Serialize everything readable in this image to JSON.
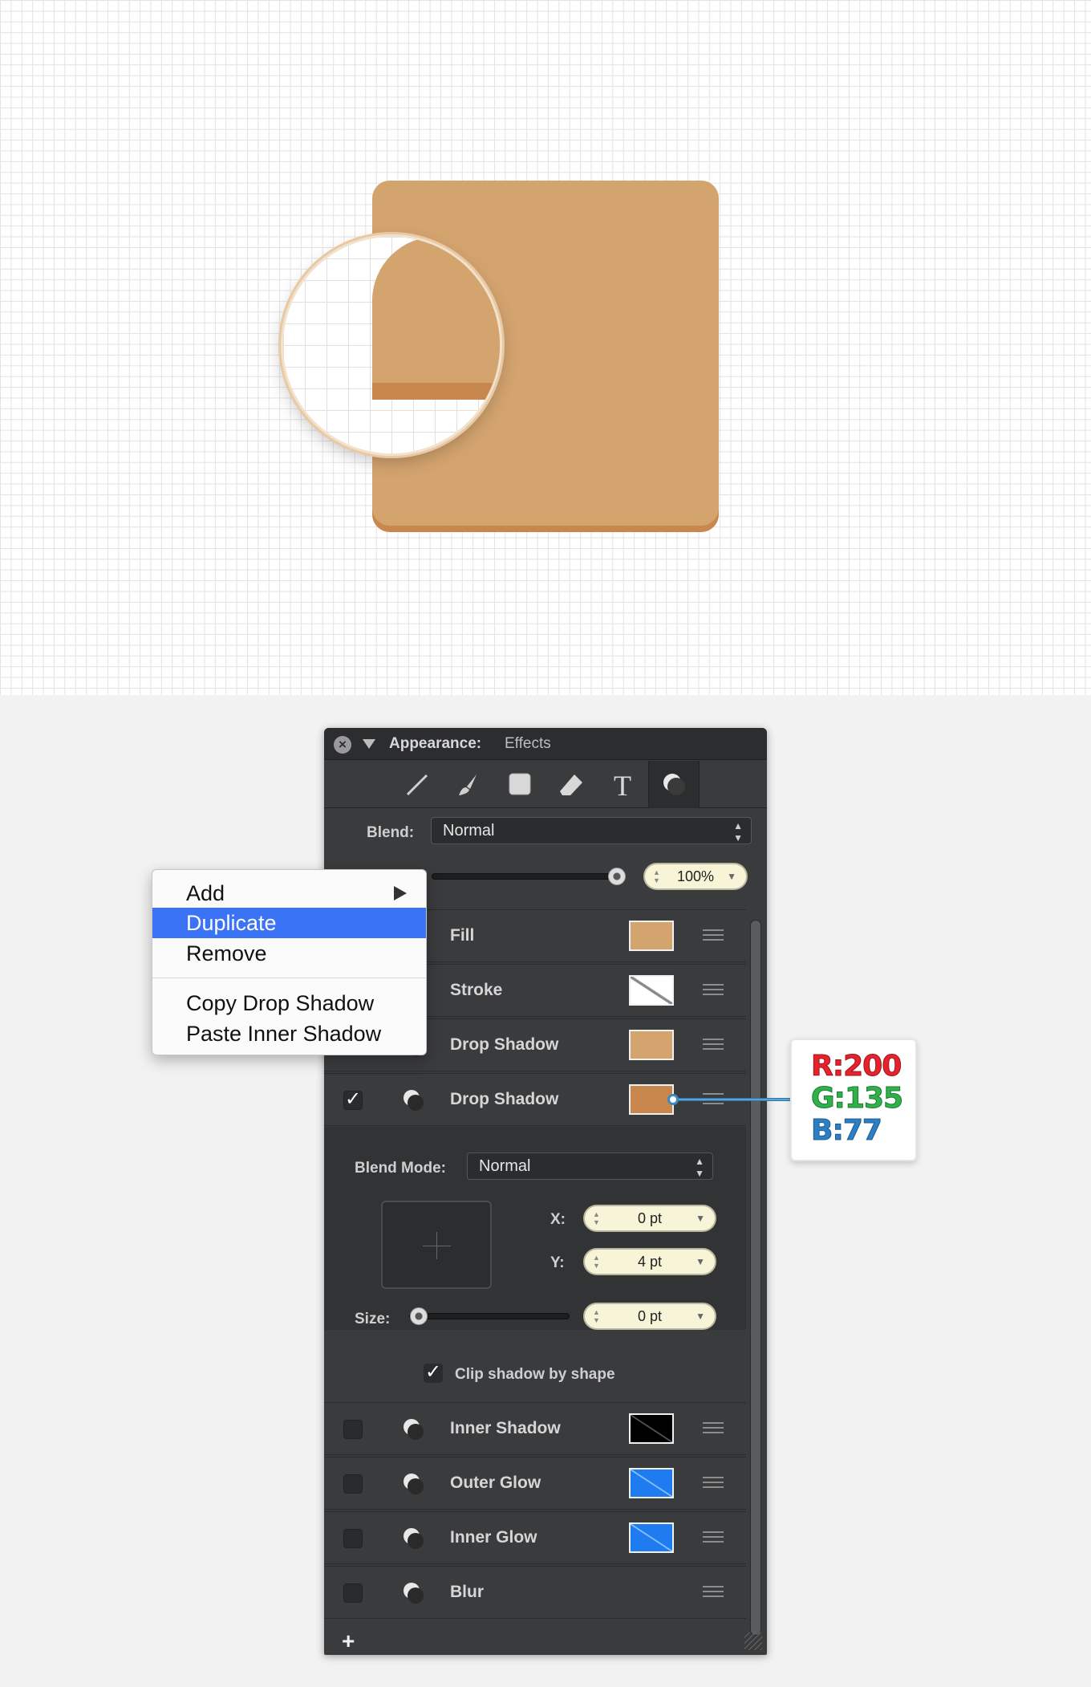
{
  "panel": {
    "title": "Appearance:",
    "subtitle": "Effects",
    "blend_label": "Blend:",
    "blend_value": "Normal",
    "opacity_value": "100%",
    "blend_mode_label": "Blend Mode:",
    "blend_mode_value": "Normal",
    "x_label": "X:",
    "x_value": "0 pt",
    "y_label": "Y:",
    "y_value": "4 pt",
    "size_label": "Size:",
    "size_value": "0 pt",
    "clip_label": "Clip shadow by shape",
    "add_label": "+"
  },
  "tools": [
    "pen-tool",
    "brush-tool",
    "shape-tool",
    "eraser-tool",
    "text-tool",
    "effects-tool"
  ],
  "effects": [
    {
      "name": "Fill",
      "checked": false,
      "swatch": "#d4a46f"
    },
    {
      "name": "Stroke",
      "checked": false,
      "swatch": "none"
    },
    {
      "name": "Drop Shadow",
      "checked": false,
      "swatch": "#d4a46f"
    },
    {
      "name": "Drop Shadow",
      "checked": true,
      "swatch": "#c8874d"
    },
    {
      "name": "Inner Shadow",
      "checked": false,
      "swatch": "#000000"
    },
    {
      "name": "Outer Glow",
      "checked": false,
      "swatch": "#1e7cf0"
    },
    {
      "name": "Inner Glow",
      "checked": false,
      "swatch": "#1e7cf0"
    },
    {
      "name": "Blur",
      "checked": false,
      "swatch": ""
    }
  ],
  "menu": {
    "items": [
      "Add",
      "Duplicate",
      "Remove",
      "Copy Drop Shadow",
      "Paste Inner Shadow"
    ]
  },
  "callout": {
    "r": "R:200",
    "g": "G:135",
    "b": "B:77"
  },
  "colors": {
    "shape_fill": "#d4a46f",
    "shape_shadow": "#c8874d",
    "menu_selected": "#3a73f5"
  }
}
